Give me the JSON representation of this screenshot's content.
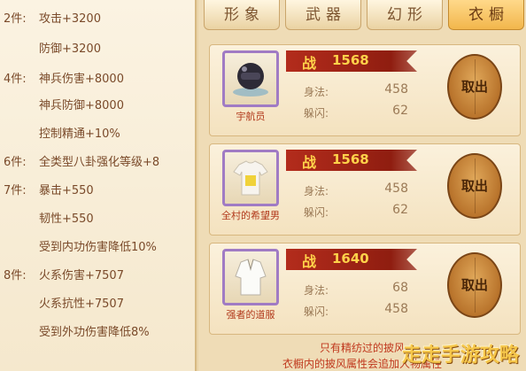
{
  "set_bonus": [
    {
      "tier": "2件:",
      "stat": "攻击+3200"
    },
    {
      "tier": "",
      "stat": "防御+3200"
    },
    {
      "tier": "4件:",
      "stat": "神兵伤害+8000"
    },
    {
      "tier": "",
      "stat": "神兵防御+8000"
    },
    {
      "tier": "",
      "stat": "控制精通+10%"
    },
    {
      "tier": "6件:",
      "stat": "全类型八卦强化等级+8"
    },
    {
      "tier": "7件:",
      "stat": "暴击+550"
    },
    {
      "tier": "",
      "stat": "韧性+550"
    },
    {
      "tier": "",
      "stat": "受到内功伤害降低10%"
    },
    {
      "tier": "8件:",
      "stat": "火系伤害+7507"
    },
    {
      "tier": "",
      "stat": "火系抗性+7507"
    },
    {
      "tier": "",
      "stat": "受到外功伤害降低8%"
    }
  ],
  "tabs": [
    "形象",
    "武器",
    "幻形",
    "衣橱"
  ],
  "active_tab": 3,
  "items": [
    {
      "name": "宇航员",
      "zhan": "战",
      "power": "1568",
      "attr1_label": "身法:",
      "attr1_value": "458",
      "attr2_label": "躲闪:",
      "attr2_value": "62",
      "button": "取出",
      "icon": "astronaut-outfit-icon"
    },
    {
      "name": "全村的希望男",
      "zhan": "战",
      "power": "1568",
      "attr1_label": "身法:",
      "attr1_value": "458",
      "attr2_label": "躲闪:",
      "attr2_value": "62",
      "button": "取出",
      "icon": "village-shirt-icon"
    },
    {
      "name": "强者的道服",
      "zhan": "战",
      "power": "1640",
      "attr1_label": "身法:",
      "attr1_value": "68",
      "attr2_label": "躲闪:",
      "attr2_value": "458",
      "button": "取出",
      "icon": "dao-robe-icon"
    }
  ],
  "footer": {
    "line1": "只有精纺过的披风",
    "line2": "衣橱内的披风属性会追加人物属性"
  },
  "watermark": "走走手游攻略",
  "colors": {
    "accent_red": "#b32c1c",
    "power_gold": "#ffd24a",
    "frame_purple": "#a07bc4"
  }
}
